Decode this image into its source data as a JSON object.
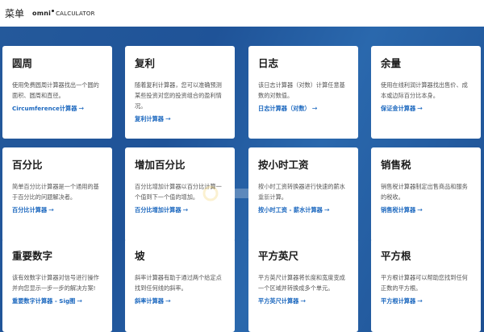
{
  "header": {
    "menu_label": "菜单",
    "logo_bold": "omni",
    "logo_regular": "CALCULATOR"
  },
  "cards": [
    {
      "title": "圆周",
      "desc": "使用免费圆周计算器找出一个圆的面积、圆周和直径。",
      "link": "Circumference计算器"
    },
    {
      "title": "复利",
      "desc": "随着复利计算器，您可以准确预测某些投资对您的投资组合的盈利情况。",
      "link": "复利计算器"
    },
    {
      "title": "日志",
      "desc": "该日志计算器（对数）计算任意基数的对数值。",
      "link": "日志计算器（对数）"
    },
    {
      "title": "余量",
      "desc": "使用在线利润计算器找出售价、成本或边际百分比本身。",
      "link": "保证金计算器"
    },
    {
      "title": "百分比",
      "desc": "简单百分比计算器是一个通用的基于百分比的问题解决者。",
      "link": "百分比计算器"
    },
    {
      "title": "增加百分比",
      "desc": "百分比增加计算器以百分比计算一个值到下一个值的增加。",
      "link": "百分比增加计算器"
    },
    {
      "title": "按小时工资",
      "desc": "按小时工资转换器进行快速的薪水重新计算。",
      "link": "按小时工资 - 薪水计算器"
    },
    {
      "title": "销售税",
      "desc": "销售税计算器制定出售商品和服务的税收。",
      "link": "销售税计算器"
    },
    {
      "title": "重要数字",
      "desc": "该有效数字计算器对信号进行操作并向您显示一步一步的解决方案!",
      "link": "重要数字计算器 - Sig图"
    },
    {
      "title": "坡",
      "desc": "斜率计算器有助于通过两个给定点找到任何线的斜率。",
      "link": "斜率计算器"
    },
    {
      "title": "平方英尺",
      "desc": "平方英尺计算器将长度和宽度变成一个区域并转换成多个单元。",
      "link": "平方英尺计算器"
    },
    {
      "title": "平方根",
      "desc": "平方根计算器可以帮助您找到任何正数的平方根。",
      "link": "平方根计算器"
    }
  ],
  "colors": {
    "accent": "#1c68bf",
    "background": "#24599b"
  }
}
